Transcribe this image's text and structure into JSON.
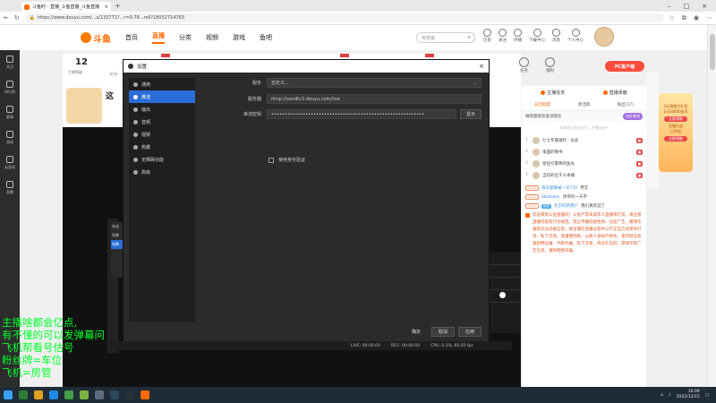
{
  "browser": {
    "tab_title": "斗鱼时 - 直播_斗鱼直播_斗鱼直播",
    "url": "https://www.douyu.com/...s/133771?...r=0.79...roll?18052714763"
  },
  "site": {
    "logo": "斗鱼",
    "nav": [
      "首页",
      "直播",
      "分类",
      "视频",
      "游戏",
      "鱼吧"
    ],
    "search_placeholder": "电竞最",
    "header_icons": [
      "历史",
      "关注",
      "开播",
      "下载中心",
      "消息",
      "个人中心"
    ]
  },
  "sidebar": [
    "关注",
    "排行榜",
    "赛事",
    "游戏",
    "云游戏",
    "直播"
  ],
  "room": {
    "level": "12",
    "level_label": "主播等级",
    "support": "支持(",
    "title": "这"
  },
  "room_icons": [
    "任务",
    "福利"
  ],
  "app_button": "PC客户端",
  "overlay_lines": [
    "主播啥都会亿点,",
    "有不懂的可以发弹幕问",
    "飞机帮看号估号",
    "粉丝牌=车位",
    "飞机=房管"
  ],
  "dialog": {
    "title": "设置",
    "menu": [
      "通用",
      "推流",
      "输出",
      "音频",
      "视频",
      "热键",
      "无障碍功能",
      "高级"
    ],
    "selected_menu": 1,
    "service_label": "服务",
    "service_value": "自定义...",
    "server_label": "服务器",
    "server_value": "rtmp://sendtc3.douyu.com/live",
    "key_label": "串流密钥",
    "key_value": "••••••••••••••••••••••••••••••••••••••••••••••••••••••••••",
    "show_button": "显示",
    "auth_label": "使用身份验证",
    "buttons": [
      "确定",
      "取消",
      "应用"
    ]
  },
  "obs_status": {
    "live": "LIVE: 00:00:00",
    "rec": "REC: 00:00:00",
    "cpu": "CPU: 0.1%, 60.00 fps"
  },
  "stream_mini": [
    "未连",
    "场景",
    "场景"
  ],
  "chat": {
    "tabs": [
      "主播任务",
      "直播贡献"
    ],
    "sub_tabs": [
      "日活跃度",
      "周活跃",
      "粉丝(17)"
    ],
    "notice": "做限量版装备领取任",
    "notice_badge": "送礼物领",
    "empty_hint": "本周暂无粉丝排行，主播加油~",
    "ranks": [
      {
        "num": "1",
        "name": "七七专属福利 · 员武"
      },
      {
        "num": "2",
        "name": "鬼面的锦书"
      },
      {
        "num": "3",
        "name": "星恒引擎降的鱼丸"
      },
      {
        "num": "4",
        "name": "当前的位于义本播"
      }
    ],
    "lines": [
      {
        "level": "LV.22",
        "text": "每天都要被一天710",
        "tail": "用交"
      },
      {
        "level": "LV.22",
        "fan": "",
        "nick": "bbcbaba:",
        "text": "你带的一天字"
      },
      {
        "level": "LV.22",
        "fan": "粉丝",
        "nick": "北京的新用户",
        "text": "我们真欢迎了"
      }
    ],
    "system_message": "欢迎来到斗鱼直播间！斗鱼严禁未成年人直播或打赏，请注意直播内容及行为规范。禁止传播低俗色情、垃圾广告、赌博诈骗等违法违规信息，如主播在直播过程中以不正当方式诱导打赏、私下交易，请谨慎判断，以防人身财产损失。请勿轻信各类招聘征婚、代练代抽、私下交易、购买礼包码、游戏币等广告信息，谨防网络诈骗。"
  },
  "ad": {
    "line1": "1元抢购大礼包",
    "line2": "1元10000金币",
    "button1": "立即领取",
    "line3": "全服大送",
    "line4": "已开启",
    "button2": "立即领取"
  },
  "taskbar": {
    "time": "10:09",
    "date": "2022/12/15"
  }
}
